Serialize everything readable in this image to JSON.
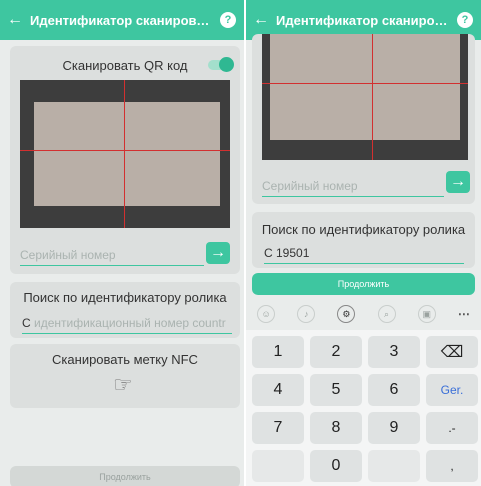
{
  "app": {
    "title": "Идентификатор сканирован...",
    "help_icon": "?"
  },
  "left": {
    "qr": {
      "label": "Сканировать QR код",
      "toggle_on": true
    },
    "serial_placeholder": "Серийный номер",
    "go_arrow": "→",
    "search": {
      "title": "Поиск по идентификатору ролика",
      "prefix": "С",
      "placeholder": "идентификационный номер countr"
    },
    "nfc": {
      "label": "Сканировать метку NFC"
    },
    "continue_label": "Продолжить"
  },
  "right": {
    "serial_placeholder": "Серийный номер",
    "go_arrow": "→",
    "search": {
      "title": "Поиск по идентификатору ролика",
      "value": "С 19501"
    },
    "continue_label": "Продолжить",
    "keyboard": {
      "row1": [
        "1",
        "2",
        "3",
        "⌫"
      ],
      "row2": [
        "4",
        "5",
        "6",
        "Ger."
      ],
      "row3": [
        "7",
        "8",
        "9",
        ".-"
      ],
      "row4": [
        "",
        "0",
        "",
        ","
      ]
    }
  },
  "colors": {
    "accent": "#3ec6a0",
    "crosshair": "#d23030",
    "key_accent": "#3a6fd8"
  }
}
